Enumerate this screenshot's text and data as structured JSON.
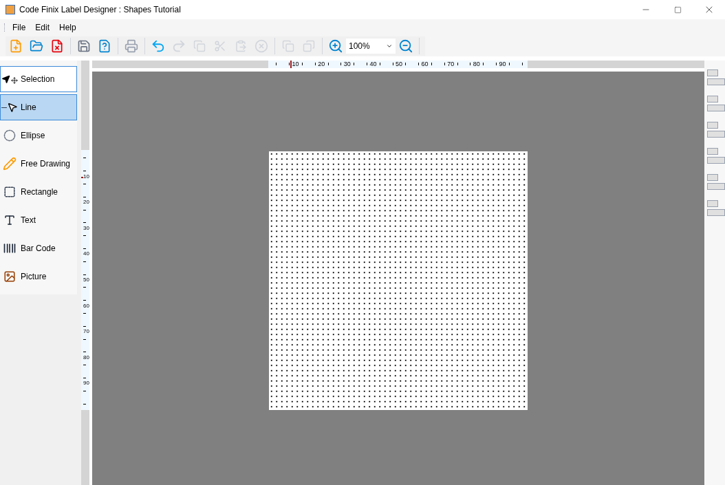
{
  "window": {
    "title": "Code Finix Label Designer : Shapes Tutorial"
  },
  "menu": [
    "File",
    "Edit",
    "Help"
  ],
  "toolbar": {
    "zoom": "100%"
  },
  "tools": [
    {
      "label": "Selection",
      "kind": "selection",
      "selected": false,
      "focused": true
    },
    {
      "label": "Line",
      "kind": "line",
      "selected": true,
      "focused": false
    },
    {
      "label": "Ellipse",
      "kind": "ellipse",
      "selected": false,
      "focused": false
    },
    {
      "label": "Free Drawing",
      "kind": "pencil",
      "selected": false,
      "focused": false
    },
    {
      "label": "Rectangle",
      "kind": "rectangle",
      "selected": false,
      "focused": false
    },
    {
      "label": "Text",
      "kind": "text",
      "selected": false,
      "focused": false
    },
    {
      "label": "Bar Code",
      "kind": "barcode",
      "selected": false,
      "focused": false
    },
    {
      "label": "Picture",
      "kind": "picture",
      "selected": false,
      "focused": false
    }
  ],
  "horizontal_ruler": [
    "10",
    "20",
    "30",
    "40",
    "50",
    "60",
    "70",
    "80",
    "90"
  ],
  "vertical_ruler": [
    "10",
    "20",
    "30",
    "40",
    "50",
    "60",
    "70",
    "80",
    "90"
  ]
}
